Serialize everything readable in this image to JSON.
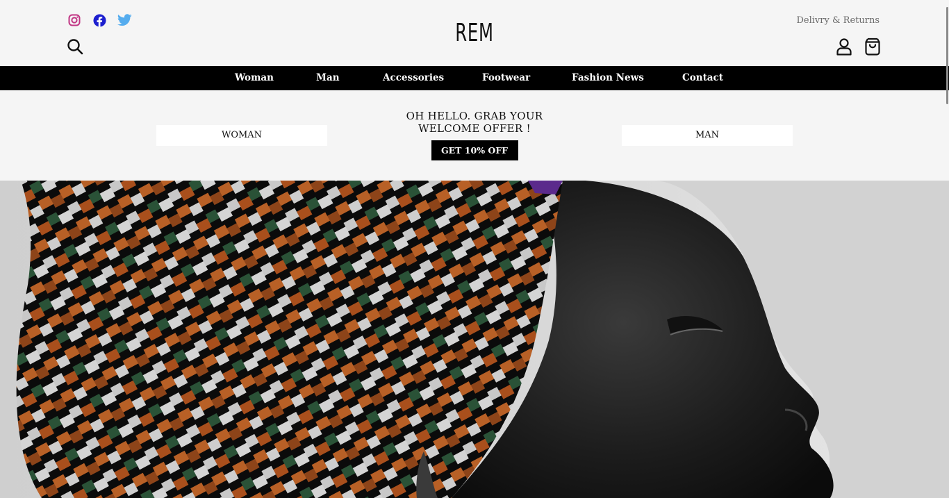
{
  "header": {
    "logo": "REM",
    "delivery_link": "Delivry & Returns",
    "social": [
      "instagram-icon",
      "facebook-icon",
      "twitter-icon"
    ],
    "icons": [
      "search-icon",
      "account-icon",
      "shopping-bag-icon"
    ]
  },
  "nav": {
    "items": [
      "Woman",
      "Man",
      "Accessories",
      "Footwear",
      "Fashion News",
      "Contact"
    ]
  },
  "promo": {
    "title_line1": "OH HELLO. GRAB YOUR",
    "title_line2": "WELCOME OFFER !",
    "offer_button": "GET 10% OFF",
    "left_button": "WOMAN",
    "right_button": "MAN"
  },
  "hero": {
    "image_alt": "Profile portrait of a woman wearing a colorful patterned head wrap"
  },
  "colors": {
    "background": "#f5f5f5",
    "nav_bar": "#000000",
    "instagram": "#c13584",
    "facebook": "#1d1fcf",
    "twitter": "#55acee"
  }
}
